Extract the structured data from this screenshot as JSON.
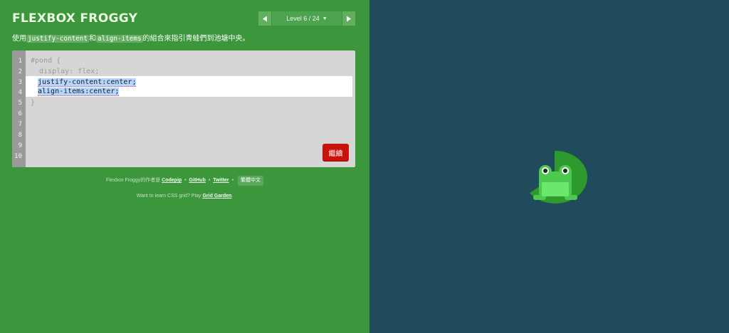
{
  "header": {
    "title": "FLEXBOX FROGGY",
    "level_label": "Level 6 / 24",
    "prev_icon": "triangle-left-icon",
    "next_icon": "triangle-right-icon"
  },
  "instructions": {
    "prefix": "使用",
    "code1": "justify-content",
    "mid": "和",
    "code2": "align-items",
    "suffix": "的組合來指引青蛙們到池塘中央。"
  },
  "editor": {
    "line_numbers": [
      "1",
      "2",
      "3",
      "4",
      "5",
      "6",
      "7",
      "8",
      "9",
      "10"
    ],
    "pre_lines": [
      "#pond {",
      "  display: flex;"
    ],
    "input_lines": [
      "justify-content:center;",
      "align-items:center;"
    ],
    "post_lines": [
      "}"
    ],
    "next_button": "繼續"
  },
  "footer": {
    "credit_prefix": "Flexbox Froggy的作者是",
    "codepip": "Codepip",
    "github": "GitHub",
    "twitter": "Twitter",
    "bullet": "•",
    "language": "繁體中文",
    "grid_prefix": "Want to learn CSS grid? Play",
    "grid_link": "Grid Garden",
    "grid_suffix": "."
  },
  "colors": {
    "sidebar": "#3c963c",
    "pond": "#1f4b5b",
    "lilypad": "#2e9a2e",
    "frog": "#4ec84e",
    "next_button": "#c8120a"
  },
  "board": {
    "icons": [
      "lilypad-icon",
      "frog-icon"
    ]
  }
}
